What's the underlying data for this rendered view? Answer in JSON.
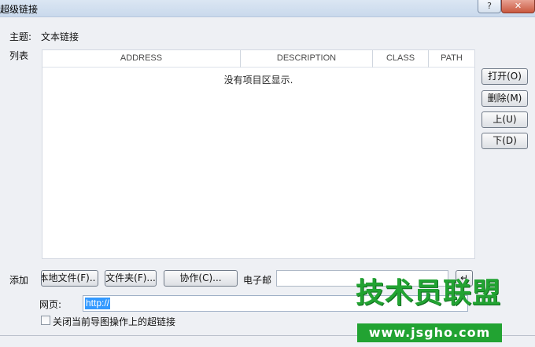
{
  "window": {
    "title": "超级链接",
    "help_glyph": "?",
    "close_glyph": "✕"
  },
  "subject": {
    "label": "主题:",
    "value": "文本链接"
  },
  "list": {
    "label": "列表",
    "columns": [
      "ADDRESS",
      "DESCRIPTION",
      "CLASS",
      "PATH"
    ],
    "rows": [],
    "empty_message": "没有项目区显示."
  },
  "side_buttons": {
    "open": "打开(O)",
    "delete": "删除(M)",
    "up": "上(U)",
    "down": "下(D)"
  },
  "add": {
    "label": "添加",
    "local_file": "本地文件(F)..",
    "folder": "文件夹(F)...",
    "collab": "协作(C)...",
    "email_label": "电子邮",
    "email_value": "",
    "enter_glyph": "↵"
  },
  "web": {
    "label": "网页:",
    "value": "http://"
  },
  "close_on_map": {
    "label": "关闭当前导图操作上的超链接",
    "checked": false
  },
  "watermark": {
    "title": "技术员联盟",
    "url": "www.jsgho.com"
  },
  "colors": {
    "dialog_bg": "#eef0f4",
    "selection": "#3399ff",
    "watermark_green": "#22a332"
  }
}
